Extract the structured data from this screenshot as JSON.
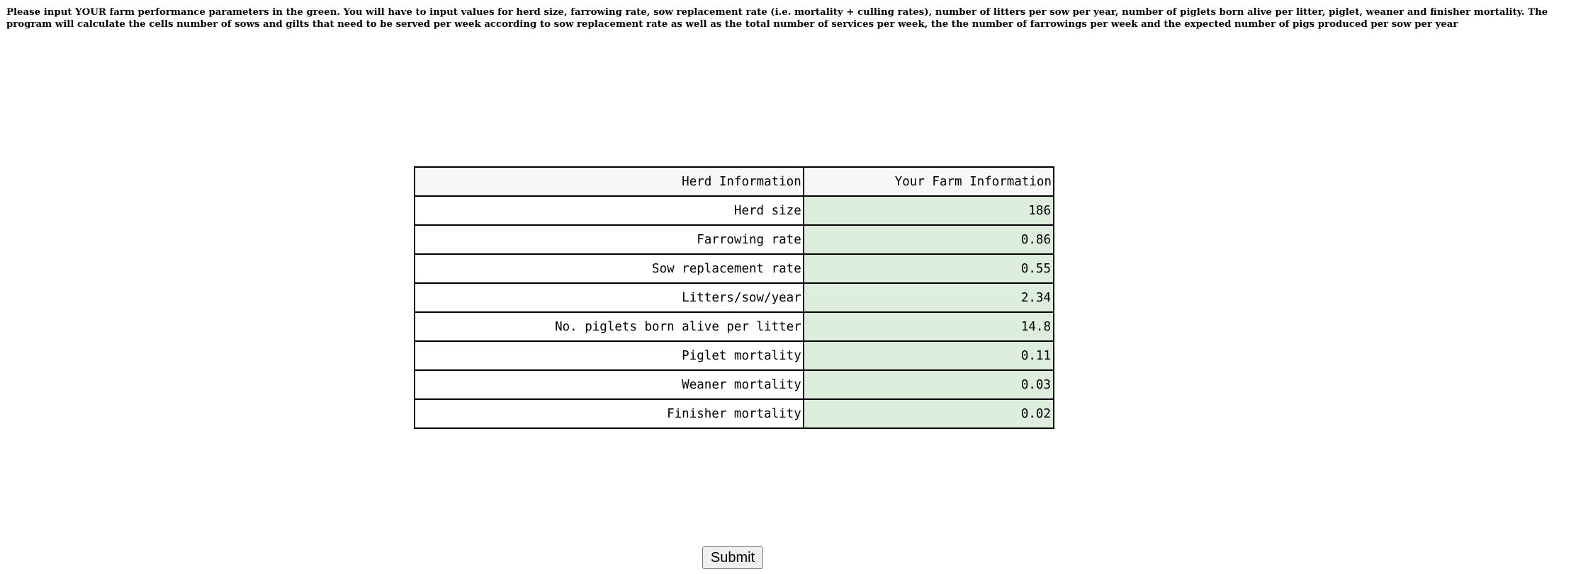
{
  "intro": {
    "text": "Please input YOUR farm performance parameters in the green. You will have to input values for herd size, farrowing rate, sow replacement rate (i.e. mortality + culling rates), number of litters per sow per year, number of piglets born alive per litter, piglet, weaner and finisher mortality. The program will calculate the cells number of sows and gilts that need to be served per week according to sow replacement rate as well as the total number of services per week, the the number of farrowings per week and the expected number of pigs produced per sow per year"
  },
  "table": {
    "header": {
      "label": "Herd Information",
      "value": "Your Farm Information"
    },
    "rows": [
      {
        "label": "Herd size",
        "value": "186"
      },
      {
        "label": "Farrowing rate",
        "value": "0.86"
      },
      {
        "label": "Sow replacement rate",
        "value": "0.55"
      },
      {
        "label": "Litters/sow/year",
        "value": "2.34"
      },
      {
        "label": "No. piglets born alive per litter",
        "value": "14.8"
      },
      {
        "label": "Piglet mortality",
        "value": "0.11"
      },
      {
        "label": "Weaner mortality",
        "value": "0.03"
      },
      {
        "label": "Finisher mortality",
        "value": "0.02"
      }
    ]
  },
  "submit": {
    "label": "Submit"
  },
  "colors": {
    "input_cell_bg": "#ddeedd",
    "header_bg": "#f7f7f7"
  }
}
